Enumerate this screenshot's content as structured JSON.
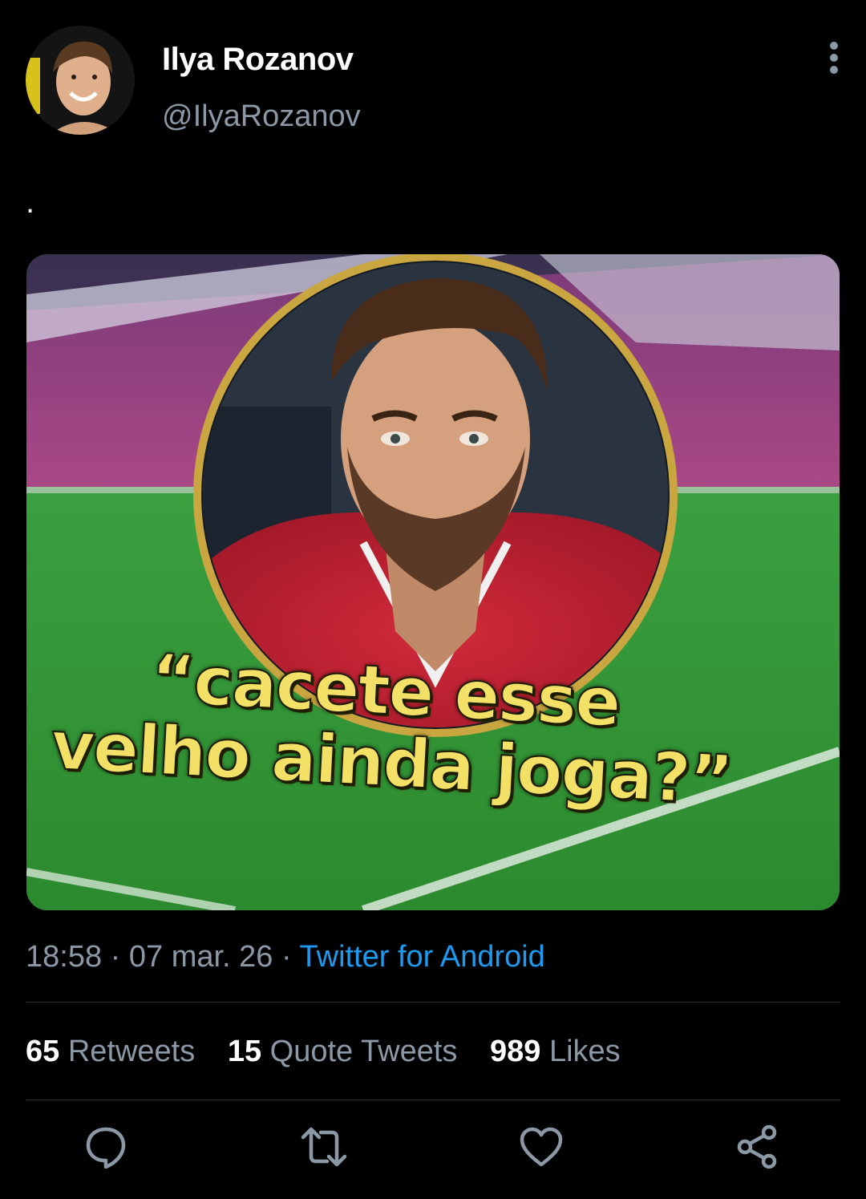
{
  "author": {
    "display_name": "Ilya Rozanov",
    "handle": "@IlyaRozanov"
  },
  "header": {
    "avatar_icon": "avatar",
    "more_icon": "vertical-ellipsis-icon"
  },
  "tweet": {
    "text": "."
  },
  "media": {
    "caption_line_1": "“cacete esse",
    "caption_line_2": "velho ainda joga?”"
  },
  "meta": {
    "time": "18:58",
    "separator_1": " · ",
    "date": "07 mar. 26",
    "separator_2": " · ",
    "source": "Twitter for Android"
  },
  "stats": {
    "retweets_count": "65",
    "retweets_label": " Retweets",
    "quotes_count": "15",
    "quotes_label": " Quote Tweets",
    "likes_count": "989",
    "likes_label": " Likes"
  },
  "actions": {
    "reply_icon": "reply-icon",
    "retweet_icon": "retweet-icon",
    "like_icon": "heart-icon",
    "share_icon": "share-icon"
  },
  "colors": {
    "background": "#000000",
    "text_primary": "#ffffff",
    "text_secondary": "#8b98a5",
    "accent": "#1d9bf0",
    "divider": "#2f3336",
    "caption_yellow": "#f3e066"
  }
}
